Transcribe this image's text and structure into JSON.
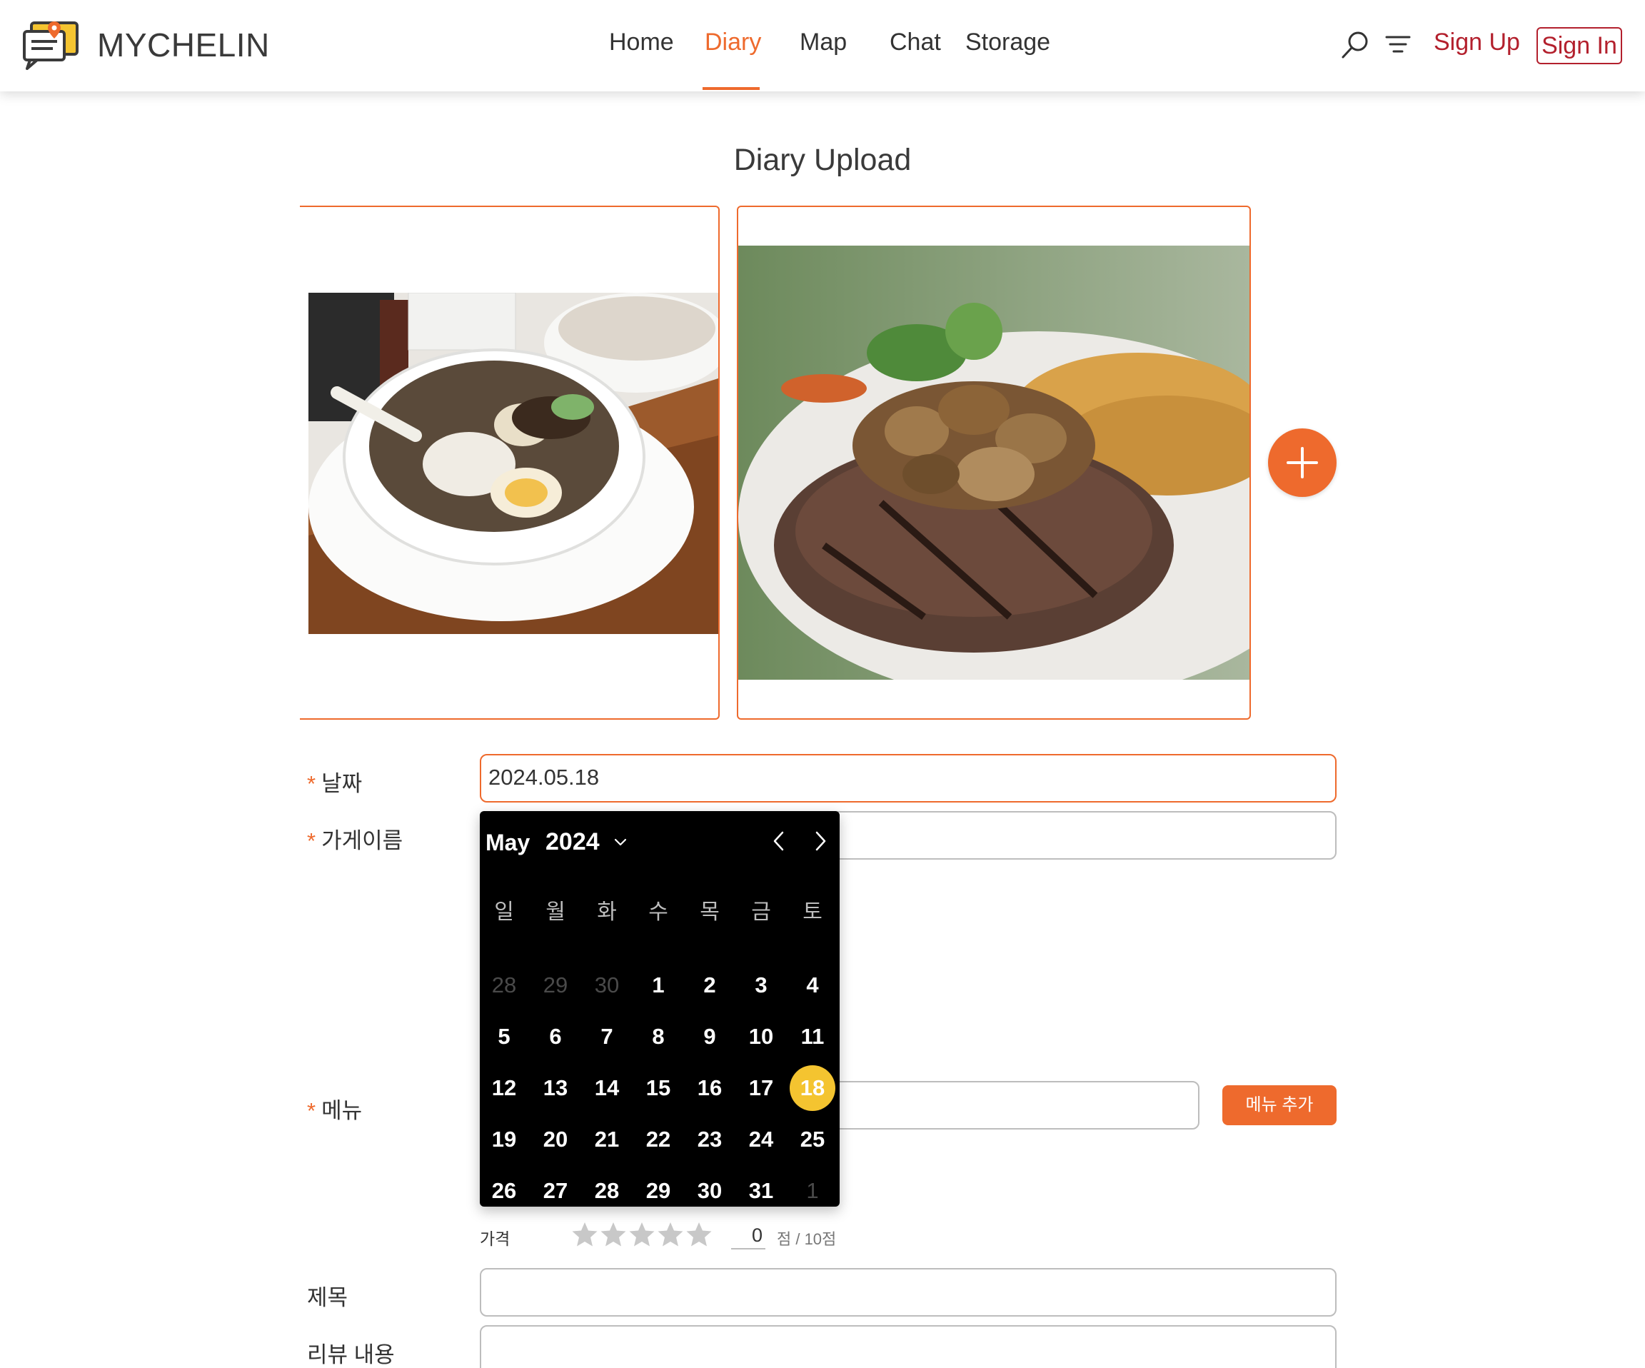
{
  "header": {
    "brand": "MYCHELIN",
    "nav": [
      "Home",
      "Diary",
      "Map",
      "Chat",
      "Storage"
    ],
    "active_nav": "Diary",
    "signup": "Sign Up",
    "signin": "Sign In"
  },
  "page": {
    "title": "Diary Upload"
  },
  "form": {
    "date_label": "날짜",
    "date_value": "2024.05.18",
    "store_label": "가게이름",
    "menu_label": "메뉴",
    "menu_add": "메뉴 추가",
    "title_label": "제목",
    "review_label": "리뷰 내용",
    "required_mark": "*"
  },
  "rating": {
    "label": "가격",
    "score": "0",
    "suffix": "점 / 10점",
    "stars_filled": 0,
    "stars_total": 5
  },
  "datepicker": {
    "month": "May",
    "year": "2024",
    "weekdays": [
      "일",
      "월",
      "화",
      "수",
      "목",
      "금",
      "토"
    ],
    "weeks": [
      [
        "28",
        "29",
        "30",
        "1",
        "2",
        "3",
        "4"
      ],
      [
        "5",
        "6",
        "7",
        "8",
        "9",
        "10",
        "11"
      ],
      [
        "12",
        "13",
        "14",
        "15",
        "16",
        "17",
        "18"
      ],
      [
        "19",
        "20",
        "21",
        "22",
        "23",
        "24",
        "25"
      ],
      [
        "26",
        "27",
        "28",
        "29",
        "30",
        "31",
        "1"
      ]
    ],
    "selected": "18"
  },
  "colors": {
    "accent": "#ee6a2d",
    "signin": "#b3202d",
    "selected_day": "#f4c430"
  },
  "icons": [
    "logo-icon",
    "search-icon",
    "filter-icon",
    "plus-icon",
    "chevron-down-icon",
    "chevron-left-icon",
    "chevron-right-icon",
    "star-icon"
  ]
}
